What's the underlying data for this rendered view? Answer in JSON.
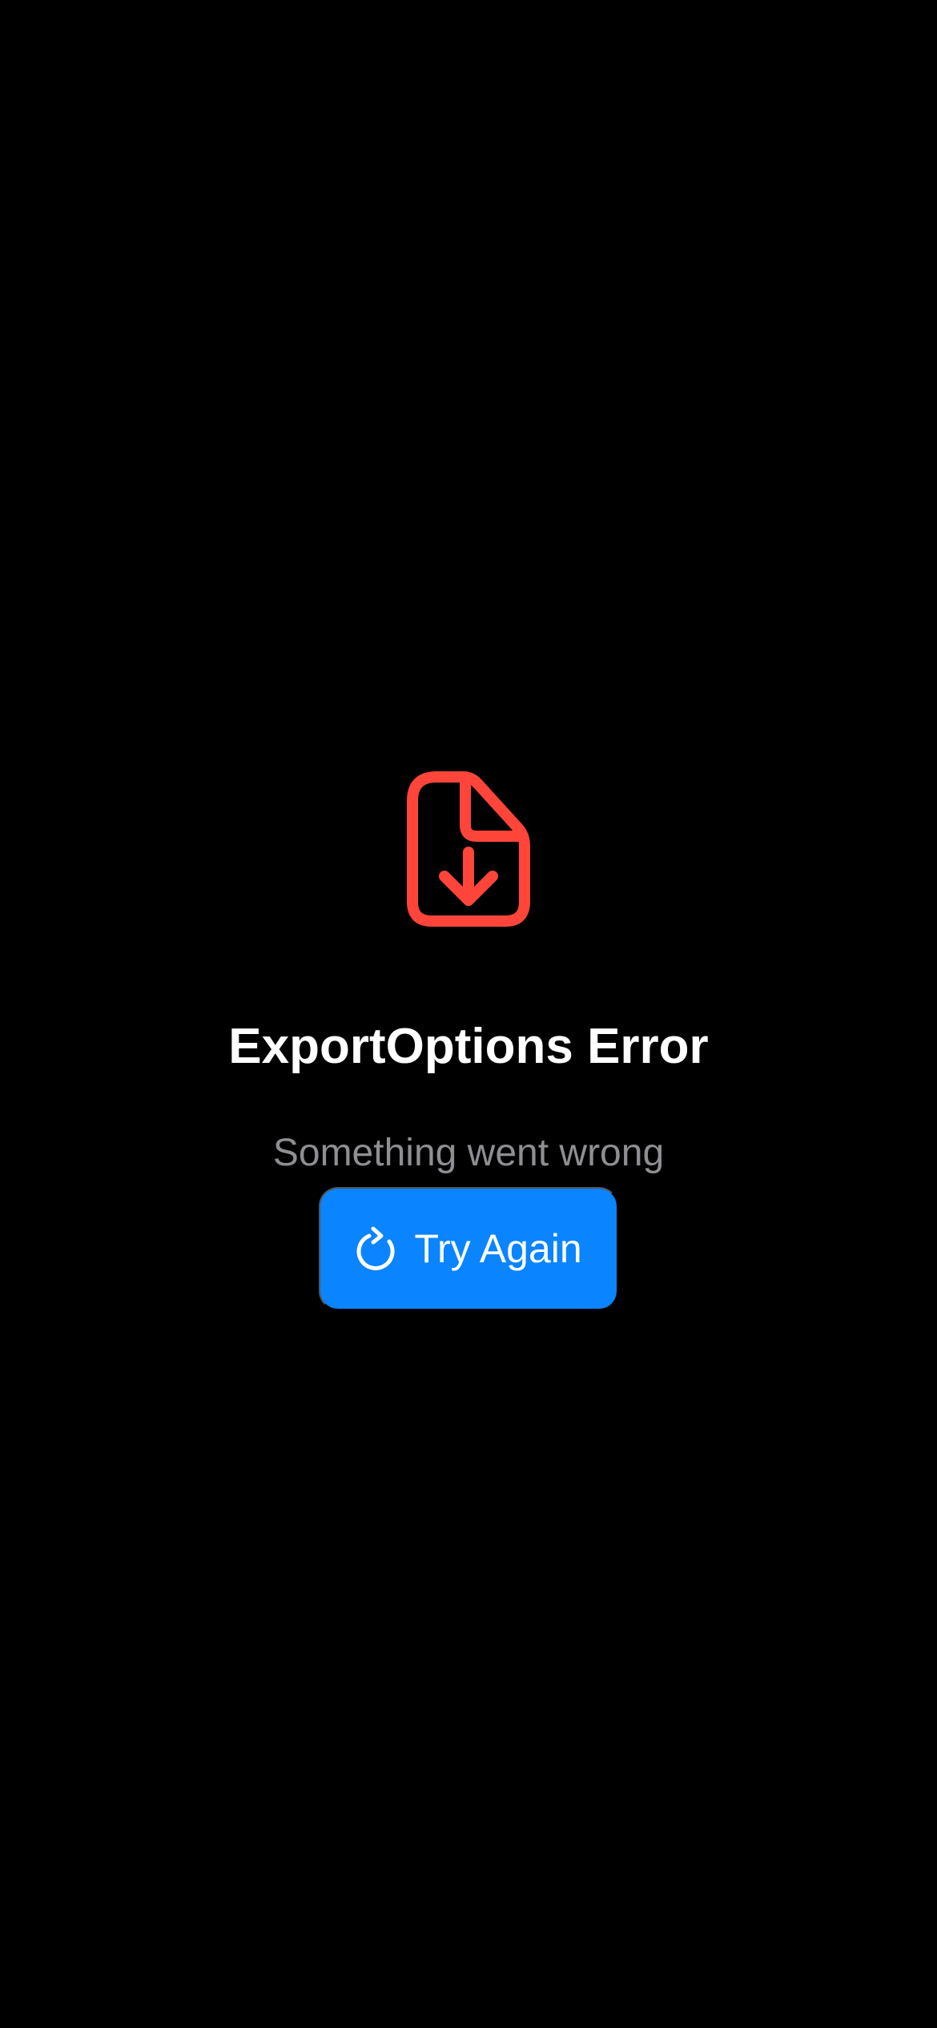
{
  "screen": {
    "background_color": "#000000"
  },
  "error": {
    "icon": "document-download-icon",
    "icon_color": "#ff453a",
    "title": "ExportOptions Error",
    "message": "Something went wrong"
  },
  "retry_button": {
    "label": "Try Again",
    "icon": "refresh-icon",
    "background_color": "#0a84ff",
    "text_color": "#ffffff"
  }
}
